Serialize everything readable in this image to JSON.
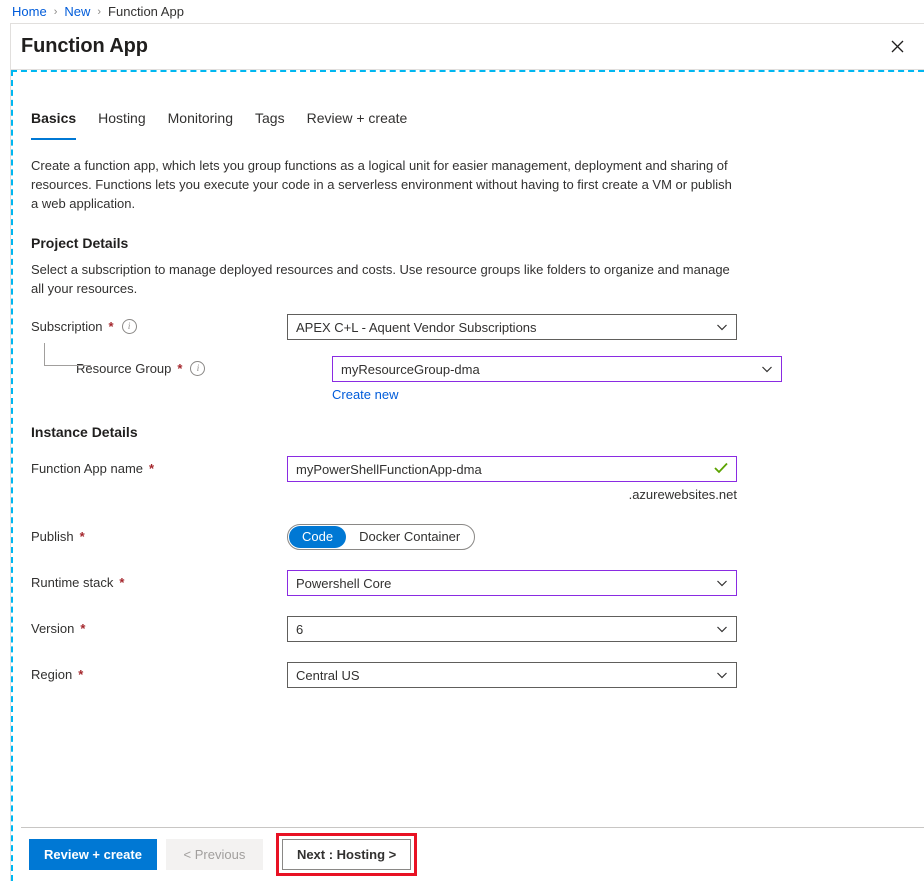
{
  "breadcrumb": {
    "items": [
      {
        "label": "Home",
        "link": true
      },
      {
        "label": "New",
        "link": true
      },
      {
        "label": "Function App",
        "link": false
      }
    ],
    "separator": "›"
  },
  "blade": {
    "title": "Function App",
    "close_icon": "close-icon"
  },
  "tabs": [
    {
      "label": "Basics",
      "active": true
    },
    {
      "label": "Hosting",
      "active": false
    },
    {
      "label": "Monitoring",
      "active": false
    },
    {
      "label": "Tags",
      "active": false
    },
    {
      "label": "Review + create",
      "active": false
    }
  ],
  "description": "Create a function app, which lets you group functions as a logical unit for easier management, deployment and sharing of resources. Functions lets you execute your code in a serverless environment without having to first create a VM or publish a web application.",
  "project_details": {
    "title": "Project Details",
    "description": "Select a subscription to manage deployed resources and costs. Use resource groups like folders to organize and manage all your resources.",
    "subscription": {
      "label": "Subscription",
      "required": "*",
      "info_icon": "info-icon",
      "value": "APEX C+L - Aquent Vendor Subscriptions"
    },
    "resource_group": {
      "label": "Resource Group",
      "required": "*",
      "info_icon": "info-icon",
      "value": "myResourceGroup-dma",
      "create_new_label": "Create new"
    }
  },
  "instance_details": {
    "title": "Instance Details",
    "function_app_name": {
      "label": "Function App name",
      "required": "*",
      "value": "myPowerShellFunctionApp-dma",
      "validation_icon": "checkmark-icon",
      "suffix": ".azurewebsites.net"
    },
    "publish": {
      "label": "Publish",
      "required": "*",
      "options": [
        {
          "label": "Code",
          "selected": true
        },
        {
          "label": "Docker Container",
          "selected": false
        }
      ]
    },
    "runtime_stack": {
      "label": "Runtime stack",
      "required": "*",
      "value": "Powershell Core"
    },
    "version": {
      "label": "Version",
      "required": "*",
      "value": "6"
    },
    "region": {
      "label": "Region",
      "required": "*",
      "value": "Central US"
    }
  },
  "footer": {
    "review_create": "Review + create",
    "previous": "< Previous",
    "next": "Next : Hosting >"
  },
  "colors": {
    "accent": "#0078d4",
    "link": "#015cda",
    "required": "#a4262c",
    "focus_border": "#8a2be2",
    "valid": "#5ba300",
    "highlight": "#e81123",
    "dashed_region": "#00b7f1"
  }
}
